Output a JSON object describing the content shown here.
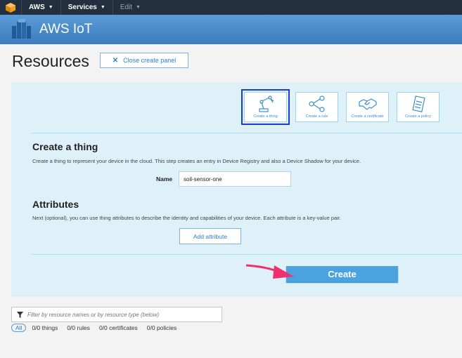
{
  "topnav": {
    "aws_label": "AWS",
    "services_label": "Services",
    "edit_label": "Edit"
  },
  "service": {
    "title": "AWS IoT"
  },
  "page": {
    "title": "Resources",
    "close_panel_label": "Close create panel"
  },
  "tiles": [
    {
      "label": "Create a thing",
      "icon": "robot-arm-icon",
      "selected": true
    },
    {
      "label": "Create a rule",
      "icon": "flow-icon",
      "selected": false
    },
    {
      "label": "Create a certificate",
      "icon": "handshake-icon",
      "selected": false
    },
    {
      "label": "Create a policy",
      "icon": "clipboard-icon",
      "selected": false
    }
  ],
  "create_thing": {
    "heading": "Create a thing",
    "description": "Create a thing to represent your device in the cloud. This step creates an entry in Device Registry and also a Device Shadow for your device.",
    "name_label": "Name",
    "name_value": "soil-sensor-one"
  },
  "attributes": {
    "heading": "Attributes",
    "description": "Next (optional), you can use thing attributes to describe the identity and capabilities of your device. Each attribute is a key-value pair.",
    "add_label": "Add attribute"
  },
  "create_button": {
    "label": "Create"
  },
  "filter": {
    "placeholder": "Filter by resource names or by resource type (below)"
  },
  "counts": {
    "all": "All",
    "things": "0/0 things",
    "rules": "0/0 rules",
    "certificates": "0/0 certificates",
    "policies": "0/0 policies"
  },
  "colors": {
    "nav_bg": "#232f3e",
    "header_blue": "#3b7cc0",
    "panel_bg": "#dff1f8",
    "accent": "#4aa3df",
    "selected_outline": "#1d3ed6",
    "arrow": "#f0306e"
  }
}
